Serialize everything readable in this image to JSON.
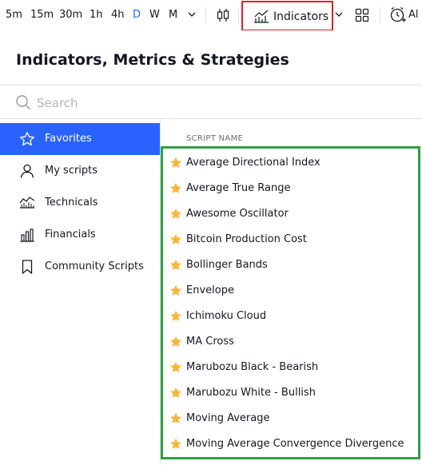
{
  "toolbar": {
    "intervals": [
      {
        "label": "5m",
        "active": false
      },
      {
        "label": "15m",
        "active": false
      },
      {
        "label": "30m",
        "active": false
      },
      {
        "label": "1h",
        "active": false
      },
      {
        "label": "4h",
        "active": false
      },
      {
        "label": "D",
        "active": true
      },
      {
        "label": "W",
        "active": false
      },
      {
        "label": "M",
        "active": false
      }
    ],
    "indicators_label": "Indicators",
    "alert_label": "Al",
    "accent_color": "#2962ff",
    "highlight_color": "#e01e2b"
  },
  "dialog": {
    "title": "Indicators, Metrics & Strategies",
    "search_placeholder": "Search",
    "column_header": "SCRIPT NAME"
  },
  "sidebar": {
    "items": [
      {
        "label": "Favorites",
        "icon": "star-outline-icon",
        "active": true
      },
      {
        "label": "My scripts",
        "icon": "user-icon",
        "active": false
      },
      {
        "label": "Technicals",
        "icon": "technicals-chart-icon",
        "active": false
      },
      {
        "label": "Financials",
        "icon": "bar-chart-icon",
        "active": false
      },
      {
        "label": "Community Scripts",
        "icon": "bookmark-icon",
        "active": false
      }
    ]
  },
  "scripts": [
    {
      "label": "Average Directional Index",
      "favorite": true
    },
    {
      "label": "Average True Range",
      "favorite": true
    },
    {
      "label": "Awesome Oscillator",
      "favorite": true
    },
    {
      "label": "Bitcoin Production Cost",
      "favorite": true
    },
    {
      "label": "Bollinger Bands",
      "favorite": true
    },
    {
      "label": "Envelope",
      "favorite": true
    },
    {
      "label": "Ichimoku Cloud",
      "favorite": true
    },
    {
      "label": "MA Cross",
      "favorite": true
    },
    {
      "label": "Marubozu Black - Bearish",
      "favorite": true
    },
    {
      "label": "Marubozu White - Bullish",
      "favorite": true
    },
    {
      "label": "Moving Average",
      "favorite": true
    },
    {
      "label": "Moving Average Convergence Divergence",
      "favorite": true
    }
  ],
  "colors": {
    "star": "#f7b53b",
    "favorites_box": "#2ea043"
  }
}
